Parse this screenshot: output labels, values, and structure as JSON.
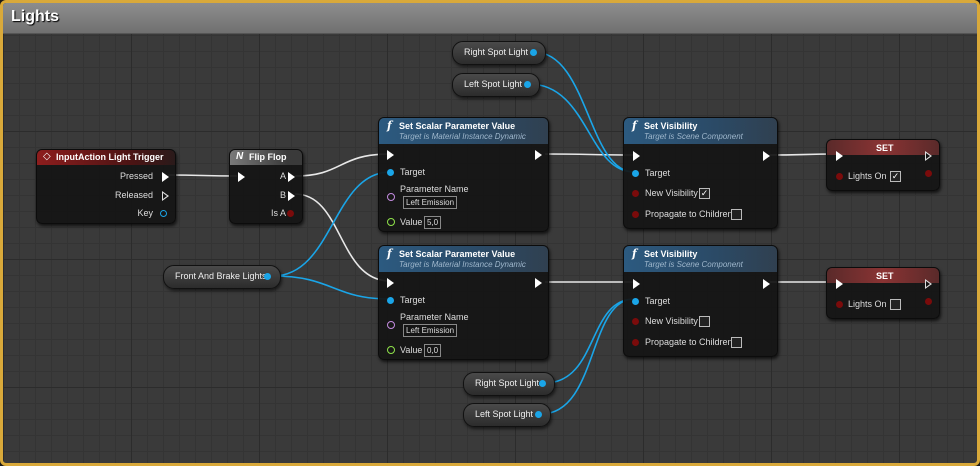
{
  "graph": {
    "title": "Lights"
  },
  "colors": {
    "exec": "#ffffff",
    "object": "#1aa5e8",
    "bool": "#7a0b0b",
    "float": "#8fe24a",
    "name": "#c48ce0",
    "frame": "#d9a93a"
  },
  "nodes": {
    "input_action": {
      "title": "InputAction Light Trigger",
      "pins": [
        "Pressed",
        "Released",
        "Key"
      ],
      "icon": "event-diamond-icon"
    },
    "flip_flop": {
      "title": "Flip Flop",
      "pins": [
        "A",
        "B",
        "Is A"
      ],
      "icon": "flipflop-icon"
    },
    "set_scalar_1": {
      "title": "Set Scalar Parameter Value",
      "subtitle": "Target is Material Instance Dynamic",
      "target": "Target",
      "param_label": "Parameter Name",
      "param_value": "Left Emission",
      "value_label": "Value",
      "value": "5,0"
    },
    "set_scalar_2": {
      "title": "Set Scalar Parameter Value",
      "subtitle": "Target is Material Instance Dynamic",
      "target": "Target",
      "param_label": "Parameter Name",
      "param_value": "Left Emission",
      "value_label": "Value",
      "value": "0,0"
    },
    "set_vis_1": {
      "title": "Set Visibility",
      "subtitle": "Target is Scene Component",
      "target": "Target",
      "new_vis": "New Visibility",
      "new_vis_checked": true,
      "propagate": "Propagate to Children",
      "propagate_checked": false
    },
    "set_vis_2": {
      "title": "Set Visibility",
      "subtitle": "Target is Scene Component",
      "target": "Target",
      "new_vis": "New Visibility",
      "new_vis_checked": false,
      "propagate": "Propagate to Children",
      "propagate_checked": false
    },
    "set_1": {
      "title": "SET",
      "var": "Lights On",
      "checked": true
    },
    "set_2": {
      "title": "SET",
      "var": "Lights On",
      "checked": false
    }
  },
  "variables": {
    "right_spot_top": "Right Spot Light",
    "left_spot_top": "Left Spot Light",
    "front_brake": "Front And Brake Lights",
    "right_spot_bottom": "Right Spot Light",
    "left_spot_bottom": "Left Spot Light"
  },
  "function_icon": "function-f-icon"
}
